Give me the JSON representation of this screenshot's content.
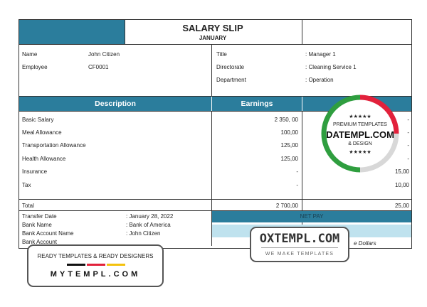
{
  "header": {
    "title": "SALARY SLIP",
    "month": "JANUARY"
  },
  "employee": [
    {
      "label": "Name",
      "value": "John Citizen"
    },
    {
      "label": "Employee",
      "value": "CF0001"
    }
  ],
  "position": [
    {
      "label": "Title",
      "value": ": Manager 1"
    },
    {
      "label": "Directorate",
      "value": ": Cleaning Service 1"
    },
    {
      "label": "Department",
      "value": ": Operation"
    }
  ],
  "table": {
    "col_description": "Description",
    "col_earnings": "Earnings",
    "rows": [
      {
        "desc": "Basic Salary",
        "earn": "2 350, 00",
        "ded": "-"
      },
      {
        "desc": "Meal Allowance",
        "earn": "100,00",
        "ded": "-"
      },
      {
        "desc": "Transportation Allowance",
        "earn": "125,00",
        "ded": "-"
      },
      {
        "desc": "Health  Allowance",
        "earn": "125,00",
        "ded": "-"
      },
      {
        "desc": "Insurance",
        "earn": "-",
        "ded": "15,00"
      },
      {
        "desc": "Tax",
        "earn": "-",
        "ded": "10,00"
      }
    ],
    "total_label": "Total",
    "total_earn": "2 700,00",
    "total_ded": "25,00"
  },
  "transfer": [
    {
      "label": "Transfer Date",
      "value": ": January 28, 2022"
    },
    {
      "label": "Bank Name",
      "value": ": Bank of America"
    },
    {
      "label": "Bank Account Name",
      "value": ": John Citizen"
    },
    {
      "label": "Bank Account",
      "value": ""
    }
  ],
  "net_pay": {
    "label": "NET PAY",
    "words": "e Dollars"
  },
  "watermark_seal": {
    "stars_top": "★★★★★",
    "line1": "PREMIUM TEMPLATES",
    "line2": "DATEMPL.COM",
    "line3": "& DESIGN",
    "stars_bottom": "★★★★★"
  },
  "watermark_ox": {
    "main": "OXTEMPL.COM",
    "sub": "WE MAKE TEMPLATES"
  },
  "watermark_my": {
    "top": "READY TEMPLATES & READY DESIGNERS",
    "bottom": "MYTEMPL.COM"
  }
}
